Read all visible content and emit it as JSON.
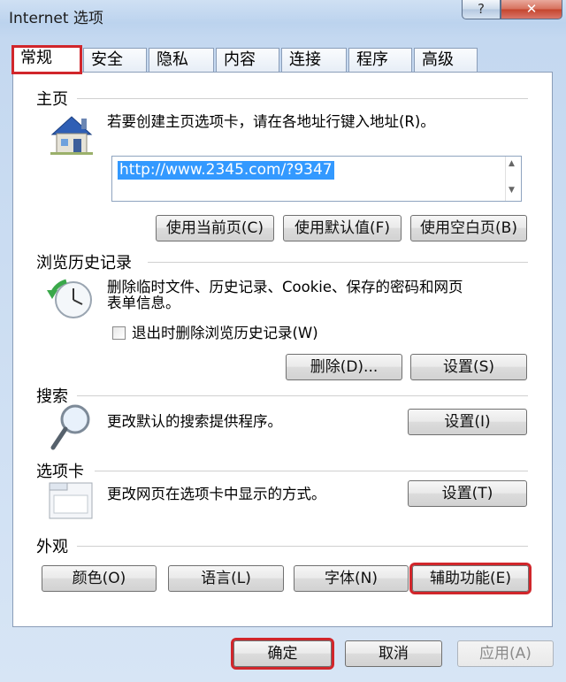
{
  "window": {
    "title": "Internet 选项",
    "help_label": "?",
    "close_label": "✕"
  },
  "tabs": [
    "常规",
    "安全",
    "隐私",
    "内容",
    "连接",
    "程序",
    "高级"
  ],
  "home": {
    "title": "主页",
    "description": "若要创建主页选项卡，请在各地址行键入地址(R)。",
    "url": "http://www.2345.com/?9347",
    "buttons": [
      "使用当前页(C)",
      "使用默认值(F)",
      "使用空白页(B)"
    ]
  },
  "history": {
    "title": "浏览历史记录",
    "description_line1": "删除临时文件、历史记录、Cookie、保存的密码和网页",
    "description_line2": "表单信息。",
    "checkbox_label": "退出时删除浏览历史记录(W)",
    "delete_label": "删除(D)...",
    "settings_label": "设置(S)"
  },
  "search": {
    "title": "搜索",
    "description": "更改默认的搜索提供程序。",
    "settings_label": "设置(I)"
  },
  "tabs_section": {
    "title": "选项卡",
    "description": "更改网页在选项卡中显示的方式。",
    "settings_label": "设置(T)"
  },
  "appearance": {
    "title": "外观",
    "buttons": [
      "颜色(O)",
      "语言(L)",
      "字体(N)",
      "辅助功能(E)"
    ]
  },
  "footer": {
    "ok_label": "确定",
    "cancel_label": "取消",
    "apply_label": "应用(A)"
  },
  "colors": {
    "highlight": "#d1262b",
    "selection": "#3399ff"
  }
}
